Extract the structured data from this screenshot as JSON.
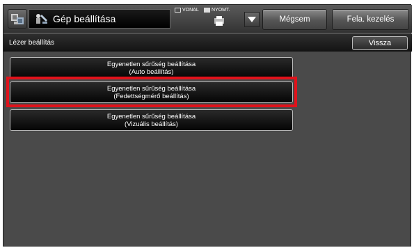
{
  "header": {
    "title": "Gép beállítása",
    "indicators": [
      {
        "label": "VONAL",
        "filled": false
      },
      {
        "label": "NYOMT.",
        "filled": true
      }
    ],
    "dropdown_icon": "triangle-down",
    "cancel_label": "Mégsem",
    "job_status_label": "Fela. kezelés"
  },
  "subheader": {
    "title": "Lézer beállítás",
    "back_label": "Vissza"
  },
  "options": [
    {
      "line1": "Egyenetlen sűrűség beállítása",
      "line2": "(Auto beállítás)"
    },
    {
      "line1": "Egyenetlen sűrűség beállítása",
      "line2": "(Fedettségmérő beállítás)",
      "highlighted": true
    },
    {
      "line1": "Egyenetlen sűrűség beállítása",
      "line2": "(Vizuális beállítás)"
    }
  ],
  "colors": {
    "highlight": "#e1121b",
    "background": "#4a4a4a"
  }
}
